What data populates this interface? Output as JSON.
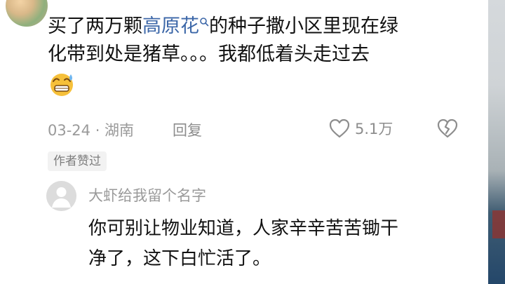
{
  "comment": {
    "text_before_keyword": "买了两万颗",
    "keyword": "高原花",
    "text_after_keyword": "的种子撒小区里现在绿",
    "line2": "化带到处是猪草。。。我都低着头走过去",
    "emoji": "cold-sweat-grin-emoji",
    "date_location": "03-24 · 湖南",
    "reply_label": "回复",
    "like_count": "5.1万",
    "author_liked_badge": "作者赞过"
  },
  "reply": {
    "username": "大虾给我留个名字",
    "line1": "你可别让物业知道，人家辛辛苦苦锄干",
    "line2": "净了，这下白忙活了。"
  },
  "icons": {
    "keyword_search": "search-icon",
    "like": "heart-outline-icon",
    "dislike": "broken-heart-icon",
    "reply_avatar": "default-avatar-icon"
  },
  "colors": {
    "keyword_link": "#3c67a8",
    "meta_text": "#9a9a9a",
    "body_text": "#111111"
  }
}
